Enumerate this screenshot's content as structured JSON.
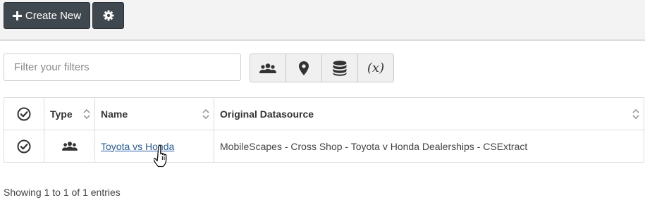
{
  "toolbar": {
    "create_label": "Create New",
    "create_icon": "plus-icon",
    "settings_icon": "gear-icon"
  },
  "filter": {
    "placeholder": "Filter your filters"
  },
  "filter_types": [
    {
      "icon": "users-icon"
    },
    {
      "icon": "map-marker-icon"
    },
    {
      "icon": "database-icon"
    },
    {
      "icon": "variable-icon",
      "label": "(x)"
    }
  ],
  "table": {
    "columns": [
      "",
      "Type",
      "Name",
      "Original Datasource"
    ],
    "rows": [
      {
        "type_icon": "users-icon",
        "name": "Toyota vs Honda",
        "datasource": "MobileScapes - Cross Shop - Toyota v Honda Dealerships - CSExtract"
      }
    ]
  },
  "footer": {
    "info": "Showing 1 to 1 of 1 entries"
  },
  "colors": {
    "dark_button": "#3f474f",
    "link": "#2a5d9f",
    "topbar_bg": "#f3f3f3"
  }
}
